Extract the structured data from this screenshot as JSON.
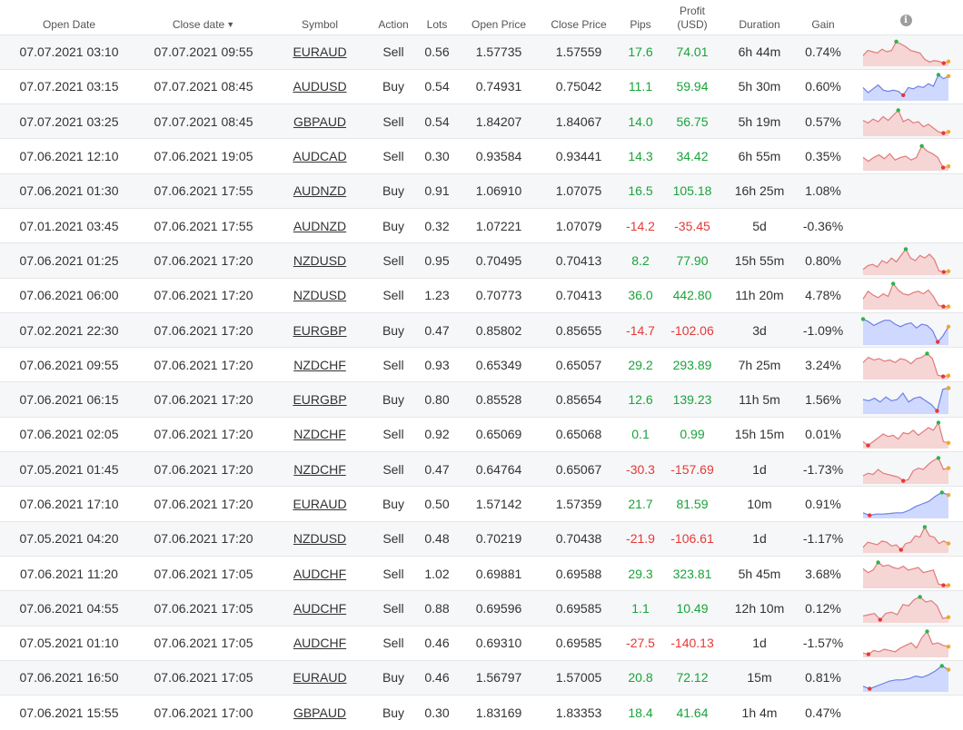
{
  "headers": {
    "open_date": "Open Date",
    "close_date": "Close date",
    "close_date_sort": "▼",
    "symbol": "Symbol",
    "action": "Action",
    "lots": "Lots",
    "open_price": "Open Price",
    "close_price": "Close Price",
    "pips": "Pips",
    "profit_line1": "Profit",
    "profit_line2": "(USD)",
    "duration": "Duration",
    "gain": "Gain",
    "info": "i"
  },
  "colors": {
    "positive": "#1aa33a",
    "negative": "#e53935",
    "sell_fill": "#f6d5d5",
    "sell_line": "#e27a7a",
    "buy_fill": "#cfd9ff",
    "buy_line": "#6f7fe6",
    "max_dot": "#2fb24a",
    "min_dot": "#e53935",
    "end_dot": "#f5a623"
  },
  "rows": [
    {
      "open_date": "07.07.2021 03:10",
      "close_date": "07.07.2021 09:55",
      "symbol": "EURAUD",
      "action": "Sell",
      "lots": "0.56",
      "open_price": "1.57735",
      "close_price": "1.57559",
      "pips": "17.6",
      "profit": "74.01",
      "duration": "6h 44m",
      "gain": "0.74%",
      "sentiment": "pos",
      "spark": [
        0.35,
        0.55,
        0.5,
        0.45,
        0.6,
        0.5,
        0.55,
        0.9,
        0.8,
        0.7,
        0.55,
        0.5,
        0.45,
        0.2,
        0.1,
        0.15,
        0.12,
        0.05,
        0.12
      ]
    },
    {
      "open_date": "07.07.2021 03:15",
      "close_date": "07.07.2021 08:45",
      "symbol": "AUDUSD",
      "action": "Buy",
      "lots": "0.54",
      "open_price": "0.74931",
      "close_price": "0.75042",
      "pips": "11.1",
      "profit": "59.94",
      "duration": "5h 30m",
      "gain": "0.60%",
      "sentiment": "pos",
      "spark": [
        0.45,
        0.25,
        0.4,
        0.55,
        0.35,
        0.3,
        0.35,
        0.3,
        0.15,
        0.45,
        0.4,
        0.5,
        0.45,
        0.6,
        0.5,
        0.95,
        0.8,
        0.9
      ]
    },
    {
      "open_date": "07.07.2021 03:25",
      "close_date": "07.07.2021 08:45",
      "symbol": "GBPAUD",
      "action": "Sell",
      "lots": "0.54",
      "open_price": "1.84207",
      "close_price": "1.84067",
      "pips": "14.0",
      "profit": "56.75",
      "duration": "5h 19m",
      "gain": "0.57%",
      "sentiment": "pos",
      "spark": [
        0.55,
        0.45,
        0.6,
        0.5,
        0.7,
        0.55,
        0.75,
        0.95,
        0.5,
        0.6,
        0.45,
        0.5,
        0.3,
        0.4,
        0.25,
        0.1,
        0.05,
        0.1
      ]
    },
    {
      "open_date": "07.06.2021 12:10",
      "close_date": "07.06.2021 19:05",
      "symbol": "AUDCAD",
      "action": "Sell",
      "lots": "0.30",
      "open_price": "0.93584",
      "close_price": "0.93441",
      "pips": "14.3",
      "profit": "34.42",
      "duration": "6h 55m",
      "gain": "0.35%",
      "sentiment": "pos",
      "spark": [
        0.45,
        0.3,
        0.45,
        0.55,
        0.4,
        0.6,
        0.35,
        0.45,
        0.5,
        0.35,
        0.45,
        0.9,
        0.7,
        0.6,
        0.45,
        0.05,
        0.1
      ]
    },
    {
      "open_date": "07.06.2021 01:30",
      "close_date": "07.06.2021 17:55",
      "symbol": "AUDNZD",
      "action": "Buy",
      "lots": "0.91",
      "open_price": "1.06910",
      "close_price": "1.07075",
      "pips": "16.5",
      "profit": "105.18",
      "duration": "16h 25m",
      "gain": "1.08%",
      "sentiment": "pos",
      "spark": []
    },
    {
      "open_date": "07.01.2021 03:45",
      "close_date": "07.06.2021 17:55",
      "symbol": "AUDNZD",
      "action": "Buy",
      "lots": "0.32",
      "open_price": "1.07221",
      "close_price": "1.07079",
      "pips": "-14.2",
      "profit": "-35.45",
      "duration": "5d",
      "gain": "-0.36%",
      "sentiment": "neg",
      "spark": []
    },
    {
      "open_date": "07.06.2021 01:25",
      "close_date": "07.06.2021 17:20",
      "symbol": "NZDUSD",
      "action": "Sell",
      "lots": "0.95",
      "open_price": "0.70495",
      "close_price": "0.70413",
      "pips": "8.2",
      "profit": "77.90",
      "duration": "15h 55m",
      "gain": "0.80%",
      "sentiment": "pos",
      "spark": [
        0.15,
        0.3,
        0.35,
        0.25,
        0.5,
        0.4,
        0.6,
        0.45,
        0.7,
        0.95,
        0.6,
        0.5,
        0.7,
        0.6,
        0.75,
        0.55,
        0.1,
        0.05,
        0.08
      ]
    },
    {
      "open_date": "07.06.2021 06:00",
      "close_date": "07.06.2021 17:20",
      "symbol": "NZDUSD",
      "action": "Sell",
      "lots": "1.23",
      "open_price": "0.70773",
      "close_price": "0.70413",
      "pips": "36.0",
      "profit": "442.80",
      "duration": "11h 20m",
      "gain": "4.78%",
      "sentiment": "pos",
      "spark": [
        0.35,
        0.65,
        0.5,
        0.4,
        0.55,
        0.45,
        0.95,
        0.7,
        0.55,
        0.5,
        0.6,
        0.65,
        0.55,
        0.7,
        0.45,
        0.1,
        0.05,
        0.05
      ]
    },
    {
      "open_date": "07.02.2021 22:30",
      "close_date": "07.06.2021 17:20",
      "symbol": "EURGBP",
      "action": "Buy",
      "lots": "0.47",
      "open_price": "0.85802",
      "close_price": "0.85655",
      "pips": "-14.7",
      "profit": "-102.06",
      "duration": "3d",
      "gain": "-1.09%",
      "sentiment": "neg",
      "spark": [
        0.95,
        0.85,
        0.7,
        0.8,
        0.9,
        0.9,
        0.75,
        0.65,
        0.75,
        0.8,
        0.6,
        0.75,
        0.7,
        0.5,
        0.05,
        0.3,
        0.65
      ]
    },
    {
      "open_date": "07.06.2021 09:55",
      "close_date": "07.06.2021 17:20",
      "symbol": "NZDCHF",
      "action": "Sell",
      "lots": "0.93",
      "open_price": "0.65349",
      "close_price": "0.65057",
      "pips": "29.2",
      "profit": "293.89",
      "duration": "7h 25m",
      "gain": "3.24%",
      "sentiment": "pos",
      "spark": [
        0.6,
        0.8,
        0.7,
        0.75,
        0.65,
        0.7,
        0.6,
        0.75,
        0.7,
        0.55,
        0.75,
        0.8,
        0.95,
        0.75,
        0.1,
        0.05,
        0.08
      ]
    },
    {
      "open_date": "07.06.2021 06:15",
      "close_date": "07.06.2021 17:20",
      "symbol": "EURGBP",
      "action": "Buy",
      "lots": "0.80",
      "open_price": "0.85528",
      "close_price": "0.85654",
      "pips": "12.6",
      "profit": "139.23",
      "duration": "11h 5m",
      "gain": "1.56%",
      "sentiment": "pos",
      "spark": [
        0.5,
        0.45,
        0.55,
        0.4,
        0.6,
        0.45,
        0.5,
        0.75,
        0.4,
        0.55,
        0.6,
        0.45,
        0.3,
        0.05,
        0.9,
        0.95
      ]
    },
    {
      "open_date": "07.06.2021 02:05",
      "close_date": "07.06.2021 17:20",
      "symbol": "NZDCHF",
      "action": "Sell",
      "lots": "0.92",
      "open_price": "0.65069",
      "close_price": "0.65068",
      "pips": "0.1",
      "profit": "0.99",
      "duration": "15h 15m",
      "gain": "0.01%",
      "sentiment": "pos",
      "spark": [
        0.2,
        0.05,
        0.2,
        0.35,
        0.5,
        0.4,
        0.45,
        0.3,
        0.55,
        0.5,
        0.65,
        0.45,
        0.6,
        0.75,
        0.65,
        0.95,
        0.2,
        0.15
      ]
    },
    {
      "open_date": "07.05.2021 01:45",
      "close_date": "07.06.2021 17:20",
      "symbol": "NZDCHF",
      "action": "Sell",
      "lots": "0.47",
      "open_price": "0.64764",
      "close_price": "0.65067",
      "pips": "-30.3",
      "profit": "-157.69",
      "duration": "1d",
      "gain": "-1.73%",
      "sentiment": "neg",
      "spark": [
        0.25,
        0.35,
        0.3,
        0.5,
        0.35,
        0.3,
        0.25,
        0.2,
        0.05,
        0.1,
        0.45,
        0.55,
        0.5,
        0.7,
        0.85,
        0.95,
        0.5,
        0.55
      ]
    },
    {
      "open_date": "07.06.2021 17:10",
      "close_date": "07.06.2021 17:20",
      "symbol": "EURAUD",
      "action": "Buy",
      "lots": "0.50",
      "open_price": "1.57142",
      "close_price": "1.57359",
      "pips": "21.7",
      "profit": "81.59",
      "duration": "10m",
      "gain": "0.91%",
      "sentiment": "pos",
      "spark": [
        0.15,
        0.05,
        0.1,
        0.1,
        0.12,
        0.15,
        0.15,
        0.25,
        0.4,
        0.5,
        0.6,
        0.8,
        0.95,
        0.85
      ]
    },
    {
      "open_date": "07.05.2021 04:20",
      "close_date": "07.06.2021 17:20",
      "symbol": "NZDUSD",
      "action": "Sell",
      "lots": "0.48",
      "open_price": "0.70219",
      "close_price": "0.70438",
      "pips": "-21.9",
      "profit": "-106.61",
      "duration": "1d",
      "gain": "-1.17%",
      "sentiment": "neg",
      "spark": [
        0.15,
        0.35,
        0.3,
        0.25,
        0.4,
        0.35,
        0.2,
        0.25,
        0.05,
        0.3,
        0.35,
        0.6,
        0.55,
        0.95,
        0.6,
        0.55,
        0.3,
        0.4,
        0.3
      ]
    },
    {
      "open_date": "07.06.2021 11:20",
      "close_date": "07.06.2021 17:05",
      "symbol": "AUDCHF",
      "action": "Sell",
      "lots": "1.02",
      "open_price": "0.69881",
      "close_price": "0.69588",
      "pips": "29.3",
      "profit": "323.81",
      "duration": "5h 45m",
      "gain": "3.68%",
      "sentiment": "pos",
      "spark": [
        0.7,
        0.55,
        0.65,
        0.95,
        0.8,
        0.85,
        0.75,
        0.7,
        0.8,
        0.65,
        0.7,
        0.75,
        0.55,
        0.6,
        0.65,
        0.1,
        0.05,
        0.05
      ]
    },
    {
      "open_date": "07.06.2021 04:55",
      "close_date": "07.06.2021 17:05",
      "symbol": "AUDCHF",
      "action": "Sell",
      "lots": "0.88",
      "open_price": "0.69596",
      "close_price": "0.69585",
      "pips": "1.1",
      "profit": "10.49",
      "duration": "12h 10m",
      "gain": "0.12%",
      "sentiment": "pos",
      "spark": [
        0.2,
        0.25,
        0.3,
        0.05,
        0.3,
        0.35,
        0.25,
        0.65,
        0.6,
        0.85,
        0.95,
        0.75,
        0.8,
        0.6,
        0.1,
        0.15
      ]
    },
    {
      "open_date": "07.05.2021 01:10",
      "close_date": "07.06.2021 17:05",
      "symbol": "AUDCHF",
      "action": "Sell",
      "lots": "0.46",
      "open_price": "0.69310",
      "close_price": "0.69585",
      "pips": "-27.5",
      "profit": "-140.13",
      "duration": "1d",
      "gain": "-1.57%",
      "sentiment": "neg",
      "spark": [
        0.1,
        0.05,
        0.2,
        0.15,
        0.25,
        0.2,
        0.15,
        0.3,
        0.4,
        0.5,
        0.3,
        0.7,
        0.95,
        0.45,
        0.5,
        0.4,
        0.35
      ]
    },
    {
      "open_date": "07.06.2021 16:50",
      "close_date": "07.06.2021 17:05",
      "symbol": "EURAUD",
      "action": "Buy",
      "lots": "0.46",
      "open_price": "1.56797",
      "close_price": "1.57005",
      "pips": "20.8",
      "profit": "72.12",
      "duration": "15m",
      "gain": "0.81%",
      "sentiment": "pos",
      "spark": [
        0.15,
        0.05,
        0.15,
        0.25,
        0.35,
        0.4,
        0.4,
        0.45,
        0.55,
        0.5,
        0.6,
        0.75,
        0.95,
        0.8
      ]
    },
    {
      "open_date": "07.06.2021 15:55",
      "close_date": "07.06.2021 17:00",
      "symbol": "GBPAUD",
      "action": "Buy",
      "lots": "0.30",
      "open_price": "1.83169",
      "close_price": "1.83353",
      "pips": "18.4",
      "profit": "41.64",
      "duration": "1h 4m",
      "gain": "0.47%",
      "sentiment": "pos",
      "spark": []
    }
  ]
}
